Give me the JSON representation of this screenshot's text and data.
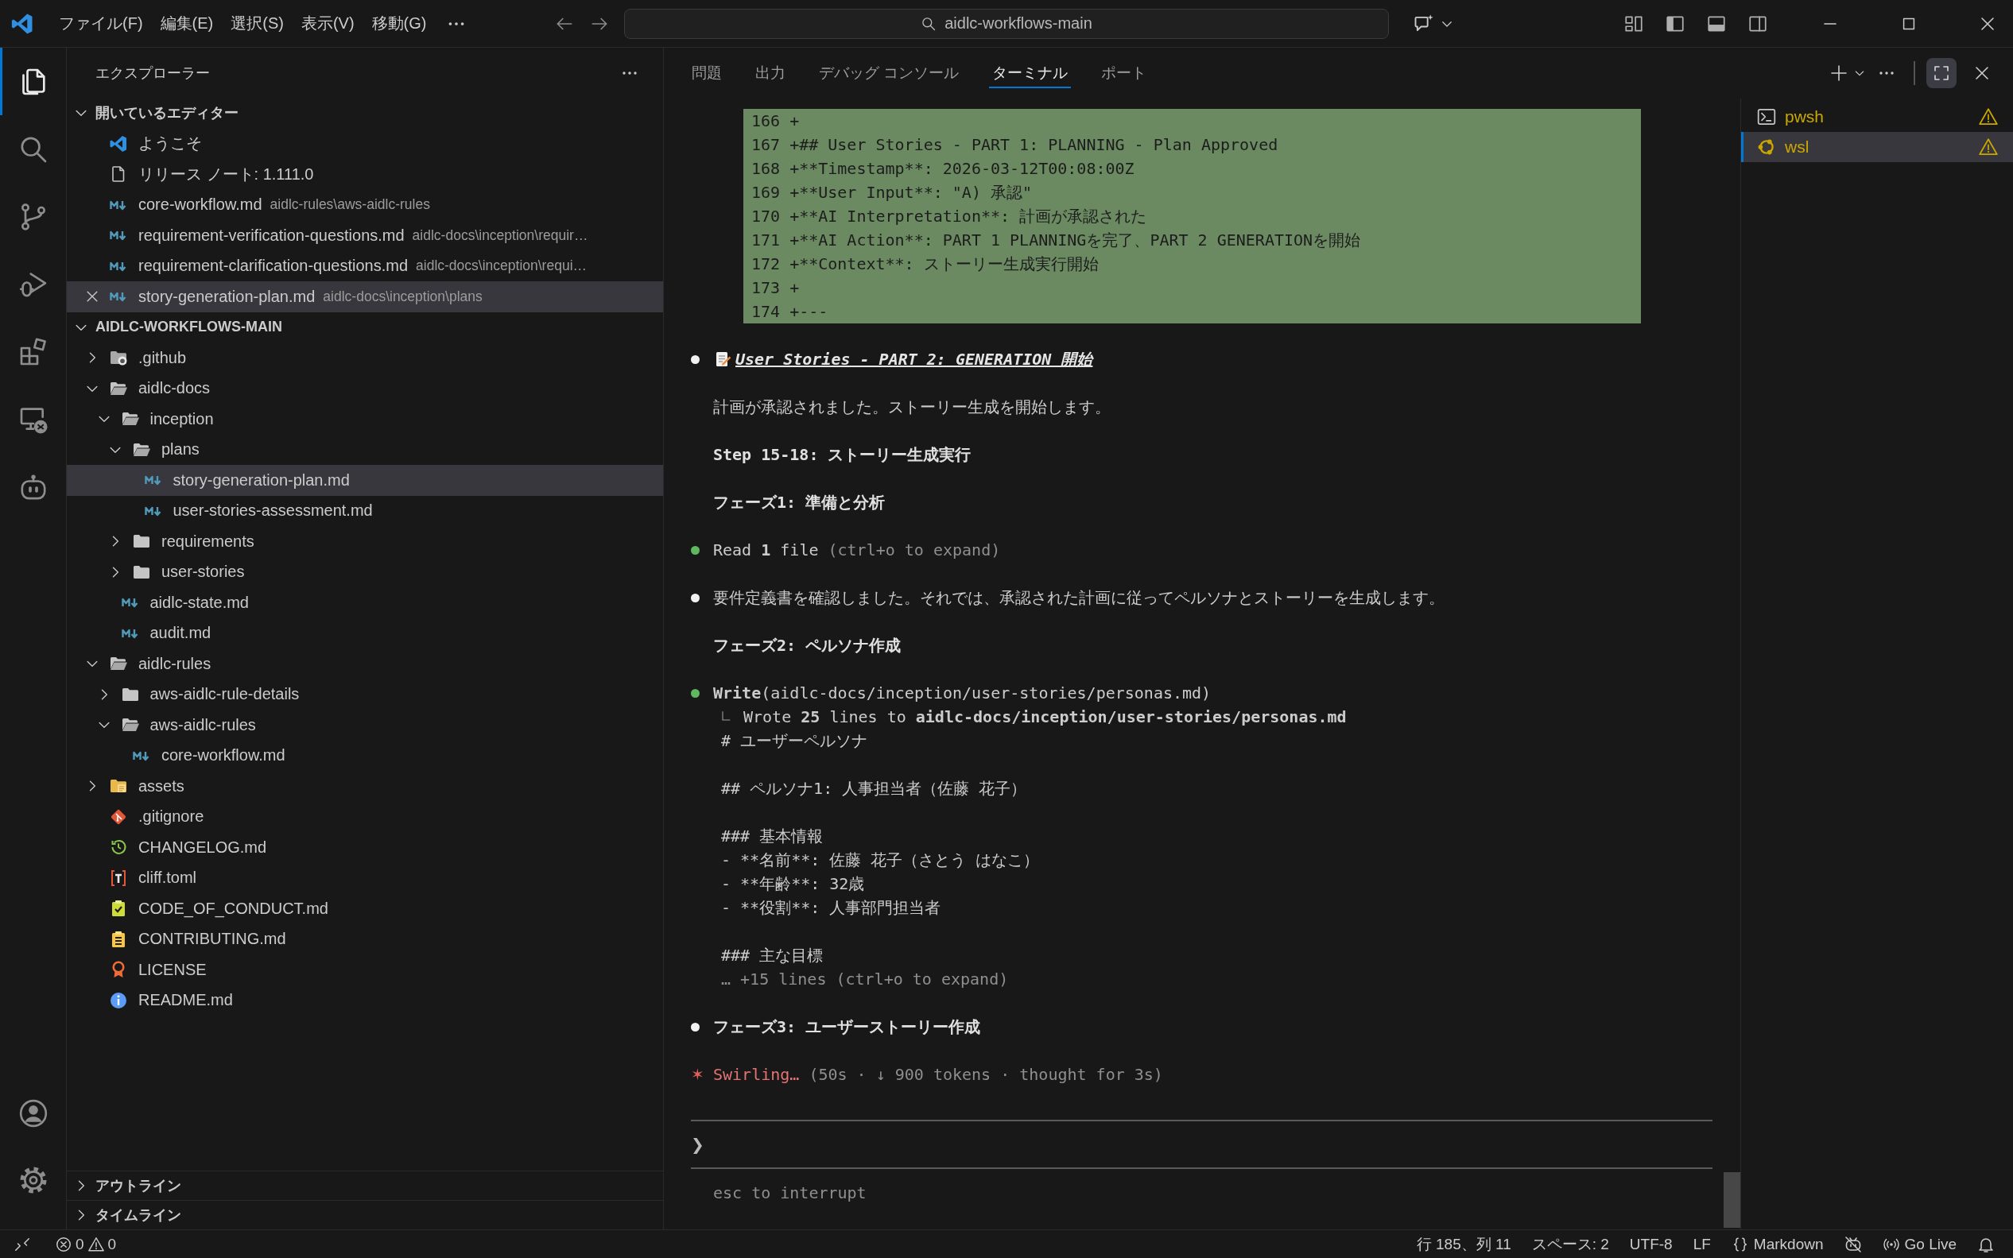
{
  "title_bar": {
    "menus": [
      "ファイル(F)",
      "編集(E)",
      "選択(S)",
      "表示(V)",
      "移動(G)"
    ],
    "search": "aidlc-workflows-main"
  },
  "activity_bar": {
    "items": [
      {
        "kind": "files",
        "selected": true
      },
      {
        "kind": "search",
        "selected": false
      },
      {
        "kind": "source-control",
        "selected": false
      },
      {
        "kind": "run-debug",
        "selected": false
      },
      {
        "kind": "extensions",
        "selected": false
      },
      {
        "kind": "remote",
        "selected": false
      },
      {
        "kind": "robot",
        "selected": false
      }
    ],
    "bottom": [
      {
        "kind": "account"
      },
      {
        "kind": "settings"
      }
    ]
  },
  "sidebar": {
    "title": "エクスプローラー",
    "open_editors": {
      "label": "開いているエディター",
      "expanded": true,
      "items": [
        {
          "kind": "vscode",
          "name": "ようこそ",
          "selected": false
        },
        {
          "kind": "document",
          "name": "リリース ノート: 1.111.0",
          "selected": false
        },
        {
          "kind": "markdown",
          "name": "core-workflow.md",
          "path": "aidlc-rules\\aws-aidlc-rules",
          "selected": false
        },
        {
          "kind": "markdown",
          "name": "requirement-verification-questions.md",
          "path": "aidlc-docs\\inception\\requir…",
          "selected": false
        },
        {
          "kind": "markdown",
          "name": "requirement-clarification-questions.md",
          "path": "aidlc-docs\\inception\\requi…",
          "selected": false
        },
        {
          "kind": "markdown",
          "name": "story-generation-plan.md",
          "path": "aidlc-docs\\inception\\plans",
          "selected": true
        }
      ]
    },
    "tree": {
      "label": "AIDLC-WORKFLOWS-MAIN",
      "expanded": true,
      "children": [
        {
          "kind": "folder-github",
          "name": ".github",
          "expanded": false,
          "selected": false
        },
        {
          "kind": "folder",
          "name": "aidlc-docs",
          "expanded": true,
          "selected": false,
          "children": [
            {
              "kind": "folder",
              "name": "inception",
              "expanded": true,
              "selected": false,
              "children": [
                {
                  "kind": "folder",
                  "name": "plans",
                  "expanded": true,
                  "selected": false,
                  "children": [
                    {
                      "kind": "markdown",
                      "name": "story-generation-plan.md",
                      "selected": true
                    },
                    {
                      "kind": "markdown",
                      "name": "user-stories-assessment.md",
                      "selected": false
                    }
                  ]
                },
                {
                  "kind": "folder",
                  "name": "requirements",
                  "expanded": false,
                  "selected": false
                },
                {
                  "kind": "folder",
                  "name": "user-stories",
                  "expanded": false,
                  "selected": false
                }
              ]
            },
            {
              "kind": "markdown",
              "name": "aidlc-state.md",
              "selected": false
            },
            {
              "kind": "markdown",
              "name": "audit.md",
              "selected": false
            }
          ]
        },
        {
          "kind": "folder",
          "name": "aidlc-rules",
          "expanded": true,
          "selected": false,
          "children": [
            {
              "kind": "folder",
              "name": "aws-aidlc-rule-details",
              "expanded": false,
              "selected": false
            },
            {
              "kind": "folder",
              "name": "aws-aidlc-rules",
              "expanded": true,
              "selected": false,
              "children": [
                {
                  "kind": "markdown",
                  "name": "core-workflow.md",
                  "selected": false
                }
              ]
            }
          ]
        },
        {
          "kind": "folder-assets",
          "name": "assets",
          "expanded": false,
          "selected": false
        },
        {
          "kind": "git",
          "name": ".gitignore",
          "selected": false
        },
        {
          "kind": "changelog",
          "name": "CHANGELOG.md",
          "selected": false
        },
        {
          "kind": "toml",
          "name": "cliff.toml",
          "selected": false
        },
        {
          "kind": "conduct",
          "name": "CODE_OF_CONDUCT.md",
          "selected": false
        },
        {
          "kind": "contributing",
          "name": "CONTRIBUTING.md",
          "selected": false
        },
        {
          "kind": "license",
          "name": "LICENSE",
          "selected": false
        },
        {
          "kind": "info",
          "name": "README.md",
          "selected": false
        }
      ]
    },
    "sections": [
      {
        "label": "アウトライン",
        "expanded": false
      },
      {
        "label": "タイムライン",
        "expanded": false
      }
    ]
  },
  "panel": {
    "tabs": [
      {
        "label": "問題",
        "selected": false
      },
      {
        "label": "出力",
        "selected": false
      },
      {
        "label": "デバッグ コンソール",
        "selected": false
      },
      {
        "label": "ターミナル",
        "selected": true
      },
      {
        "label": "ポート",
        "selected": false
      }
    ],
    "terminal": {
      "blocks": [
        {
          "kind": "diff",
          "lines": [
            {
              "number": "166",
              "text": "+"
            },
            {
              "number": "167",
              "text": "+## User Stories - PART 1: PLANNING - Plan Approved"
            },
            {
              "number": "168",
              "text": "+**Timestamp**: 2026-03-12T00:08:00Z"
            },
            {
              "number": "169",
              "text": "+**User Input**: \"A) 承認\""
            },
            {
              "number": "170",
              "text": "+**AI Interpretation**: 計画が承認された"
            },
            {
              "number": "171",
              "text": "+**AI Action**: PART 1 PLANNINGを完了、PART 2 GENERATIONを開始"
            },
            {
              "number": "172",
              "text": "+**Context**: ストーリー生成実行開始"
            },
            {
              "number": "173",
              "text": "+"
            },
            {
              "number": "174",
              "text": "+---"
            }
          ]
        },
        {
          "kind": "heading",
          "color": "#f2f2f2",
          "text": "User Stories - PART 2: GENERATION 開始"
        },
        {
          "kind": "text",
          "text": "計画が承認されました。ストーリー生成を開始します。"
        },
        {
          "kind": "bold",
          "text": "Step 15-18: ストーリー生成実行"
        },
        {
          "kind": "bold",
          "text": "フェーズ1: 準備と分析"
        },
        {
          "kind": "tool",
          "color": "#5fb85f",
          "text": "Read **1** file",
          "hint": "(ctrl+o to expand)"
        },
        {
          "kind": "text",
          "color": "#f2f2f2",
          "text": "要件定義書を確認しました。それでは、承認された計画に従ってペルソナとストーリーを生成します。"
        },
        {
          "kind": "bold",
          "text": "フェーズ2: ペルソナ作成"
        },
        {
          "kind": "tool",
          "color": "#5fb85f",
          "text": "**Write**(aidlc-docs/inception/user-stories/personas.md)",
          "result": "Wrote **25** lines to **aidlc-docs/inception/user-stories/personas.md**",
          "output": [
            [
              "# ユーザーペルソナ"
            ],
            [
              "## ペルソナ1: 人事担当者（佐藤 花子）"
            ],
            [
              "### 基本情報",
              "- **名前**: 佐藤 花子（さとう はなこ）",
              "- **年齢**: 32歳",
              "- **役割**: 人事部門担当者"
            ],
            [
              "### 主な目標"
            ]
          ],
          "more": "… +15 lines (ctrl+o to expand)"
        },
        {
          "kind": "bold",
          "color": "#f2f2f2",
          "text": "フェーズ3: ユーザーストーリー作成"
        },
        {
          "kind": "status",
          "mark": "✶",
          "text": "Swirling…",
          "detail": "(50s · ↓ 900 tokens · thought for 3s)"
        }
      ],
      "prompt": {
        "mark": "❯",
        "hint": "esc to interrupt"
      }
    },
    "terminals": [
      {
        "kind": "powershell",
        "name": "pwsh",
        "selected": false
      },
      {
        "kind": "linux",
        "name": "wsl",
        "selected": true
      }
    ]
  },
  "status_bar": {
    "errors": "0",
    "warnings": "0",
    "items": [
      {
        "kind": "text",
        "label": "行 185、列 11"
      },
      {
        "kind": "text",
        "label": "スペース: 2"
      },
      {
        "kind": "text",
        "label": "UTF-8"
      },
      {
        "kind": "text",
        "label": "LF"
      },
      {
        "kind": "language",
        "label": "Markdown"
      },
      {
        "kind": "copilot"
      },
      {
        "kind": "live",
        "label": "Go Live"
      },
      {
        "kind": "notifications"
      }
    ]
  }
}
